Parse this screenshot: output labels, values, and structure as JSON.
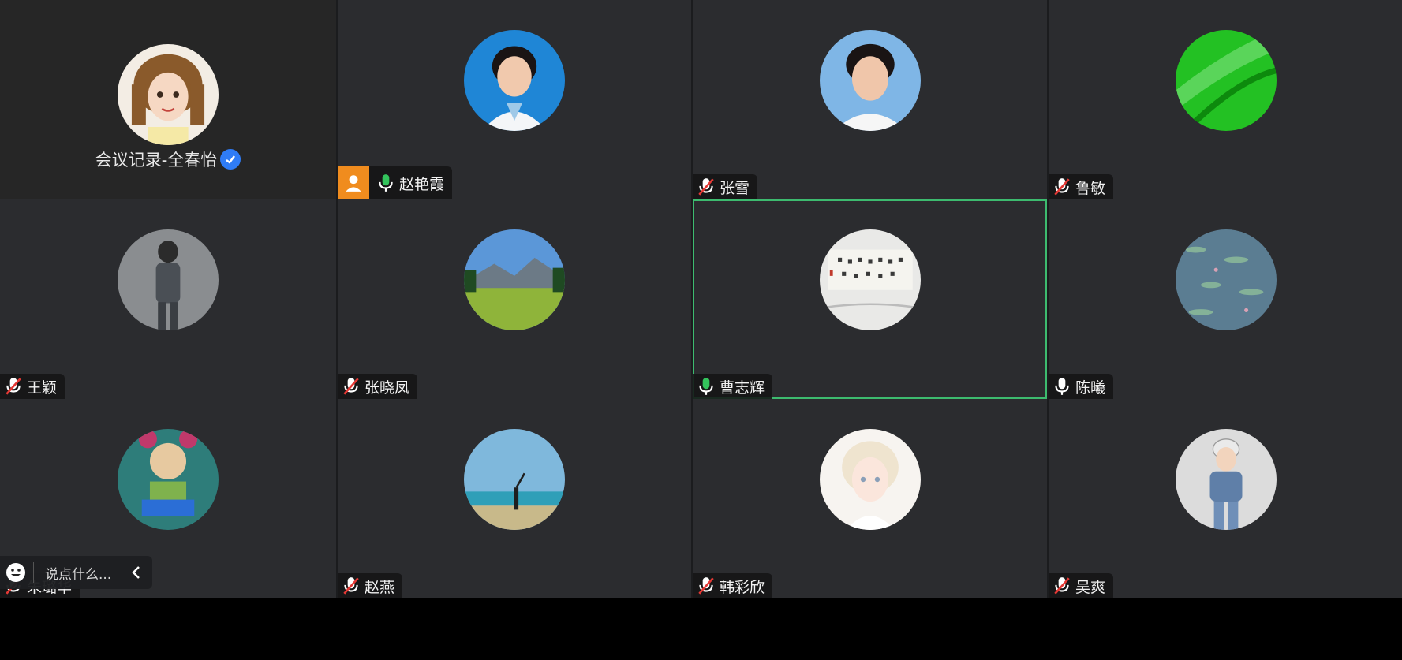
{
  "self_tile": {
    "name": "会议记录-全春怡"
  },
  "participants": [
    {
      "name": "赵艳霞",
      "mic": "on",
      "host": true
    },
    {
      "name": "张雪",
      "mic": "muted"
    },
    {
      "name": "鲁敏",
      "mic": "muted"
    },
    {
      "name": "王颖",
      "mic": "muted"
    },
    {
      "name": "张晓凤",
      "mic": "muted"
    },
    {
      "name": "曹志辉",
      "mic": "on",
      "speaking": true
    },
    {
      "name": "陈曦",
      "mic": "on-white"
    },
    {
      "name": "朱璐华",
      "mic": "muted"
    },
    {
      "name": "赵燕",
      "mic": "muted"
    },
    {
      "name": "韩彩欣",
      "mic": "muted"
    },
    {
      "name": "吴爽",
      "mic": "muted"
    }
  ],
  "chat": {
    "placeholder": "说点什么..."
  },
  "colors": {
    "speaking_border": "#3dbb6f",
    "host_badge": "#f08c1e",
    "mic_on": "#33c45c",
    "verified_badge": "#2f7cf6"
  },
  "icons": [
    "muted-mic-icon",
    "mic-icon",
    "host-icon",
    "emoji-icon",
    "chevron-left-icon",
    "verified-icon"
  ]
}
